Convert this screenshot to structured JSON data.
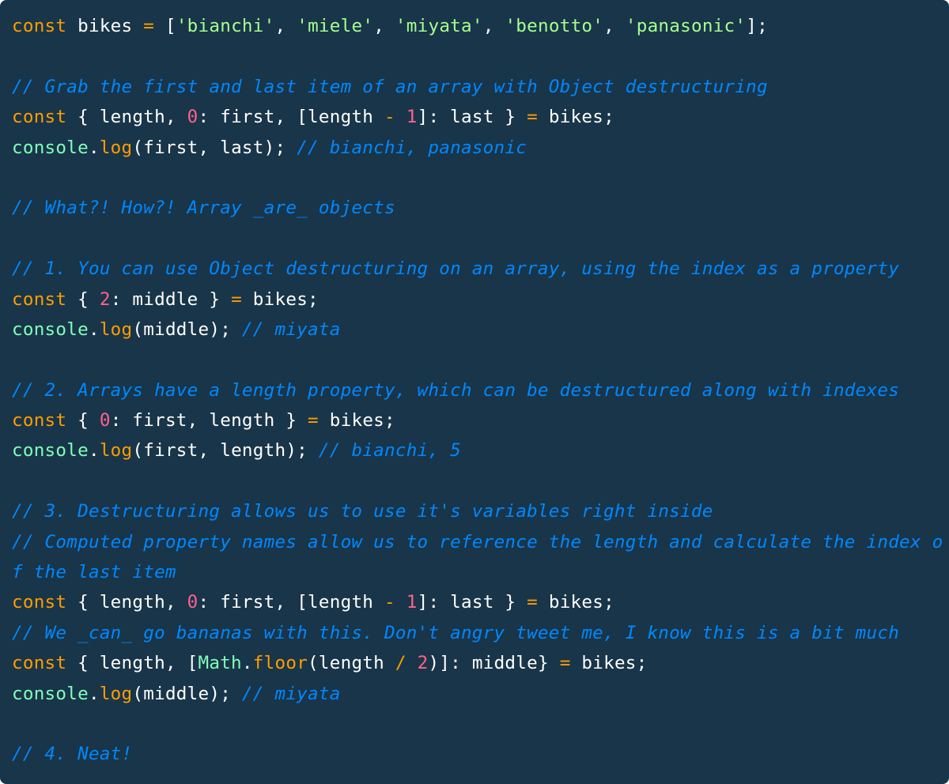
{
  "theme": {
    "background": "#193549",
    "colors": {
      "default": "#ffffff",
      "keyword": "#ff9d00",
      "operator": "#ff9d00",
      "string": "#a5ff90",
      "number": "#ff628c",
      "comment": "#0088ff",
      "builtin": "#80ffbb",
      "function": "#ffc600"
    }
  },
  "code": {
    "language": "javascript",
    "lines": [
      [
        [
          "keyword",
          "const"
        ],
        [
          "default",
          " bikes "
        ],
        [
          "operator",
          "="
        ],
        [
          "default",
          " ["
        ],
        [
          "string",
          "'bianchi'"
        ],
        [
          "default",
          ", "
        ],
        [
          "string",
          "'miele'"
        ],
        [
          "default",
          ", "
        ],
        [
          "string",
          "'miyata'"
        ],
        [
          "default",
          ", "
        ],
        [
          "string",
          "'benotto'"
        ],
        [
          "default",
          ", "
        ],
        [
          "string",
          "'panasonic'"
        ],
        [
          "default",
          "];"
        ]
      ],
      [],
      [
        [
          "comment",
          "// Grab the first and last item of an array with Object destructuring"
        ]
      ],
      [
        [
          "keyword",
          "const"
        ],
        [
          "default",
          " { length, "
        ],
        [
          "number",
          "0"
        ],
        [
          "default",
          ": first, [length "
        ],
        [
          "operator",
          "-"
        ],
        [
          "default",
          " "
        ],
        [
          "number",
          "1"
        ],
        [
          "default",
          "]: last } "
        ],
        [
          "operator",
          "="
        ],
        [
          "default",
          " bikes;"
        ]
      ],
      [
        [
          "builtin",
          "console"
        ],
        [
          "default",
          "."
        ],
        [
          "keyword",
          "log"
        ],
        [
          "default",
          "(first, last); "
        ],
        [
          "comment",
          "// bianchi, panasonic"
        ]
      ],
      [],
      [
        [
          "comment",
          "// What?! How?! Array _are_ objects"
        ]
      ],
      [],
      [
        [
          "comment",
          "// 1. You can use Object destructuring on an array, using the index as a property"
        ]
      ],
      [
        [
          "keyword",
          "const"
        ],
        [
          "default",
          " { "
        ],
        [
          "number",
          "2"
        ],
        [
          "default",
          ": middle } "
        ],
        [
          "operator",
          "="
        ],
        [
          "default",
          " bikes;"
        ]
      ],
      [
        [
          "builtin",
          "console"
        ],
        [
          "default",
          "."
        ],
        [
          "keyword",
          "log"
        ],
        [
          "default",
          "(middle); "
        ],
        [
          "comment",
          "// miyata"
        ]
      ],
      [],
      [
        [
          "comment",
          "// 2. Arrays have a length property, which can be destructured along with indexes"
        ]
      ],
      [
        [
          "keyword",
          "const"
        ],
        [
          "default",
          " { "
        ],
        [
          "number",
          "0"
        ],
        [
          "default",
          ": first, length } "
        ],
        [
          "operator",
          "="
        ],
        [
          "default",
          " bikes;"
        ]
      ],
      [
        [
          "builtin",
          "console"
        ],
        [
          "default",
          "."
        ],
        [
          "keyword",
          "log"
        ],
        [
          "default",
          "(first, length); "
        ],
        [
          "comment",
          "// bianchi, 5"
        ]
      ],
      [],
      [
        [
          "comment",
          "// 3. Destructuring allows us to use it's variables right inside"
        ]
      ],
      [
        [
          "comment",
          "// Computed property names allow us to reference the length and calculate the index o"
        ]
      ],
      [
        [
          "comment",
          "f the last item"
        ]
      ],
      [
        [
          "keyword",
          "const"
        ],
        [
          "default",
          " { length, "
        ],
        [
          "number",
          "0"
        ],
        [
          "default",
          ": first, [length "
        ],
        [
          "operator",
          "-"
        ],
        [
          "default",
          " "
        ],
        [
          "number",
          "1"
        ],
        [
          "default",
          "]: last } "
        ],
        [
          "operator",
          "="
        ],
        [
          "default",
          " bikes;"
        ]
      ],
      [
        [
          "comment",
          "// We _can_ go bananas with this. Don't angry tweet me, I know this is a bit much"
        ]
      ],
      [
        [
          "keyword",
          "const"
        ],
        [
          "default",
          " { length, ["
        ],
        [
          "builtin",
          "Math"
        ],
        [
          "default",
          "."
        ],
        [
          "keyword",
          "floor"
        ],
        [
          "default",
          "(length "
        ],
        [
          "operator",
          "/"
        ],
        [
          "default",
          " "
        ],
        [
          "number",
          "2"
        ],
        [
          "default",
          ")]: middle} "
        ],
        [
          "operator",
          "="
        ],
        [
          "default",
          " bikes;"
        ]
      ],
      [
        [
          "builtin",
          "console"
        ],
        [
          "default",
          "."
        ],
        [
          "keyword",
          "log"
        ],
        [
          "default",
          "(middle); "
        ],
        [
          "comment",
          "// miyata"
        ]
      ],
      [],
      [
        [
          "comment",
          "// 4. Neat!"
        ]
      ]
    ]
  }
}
